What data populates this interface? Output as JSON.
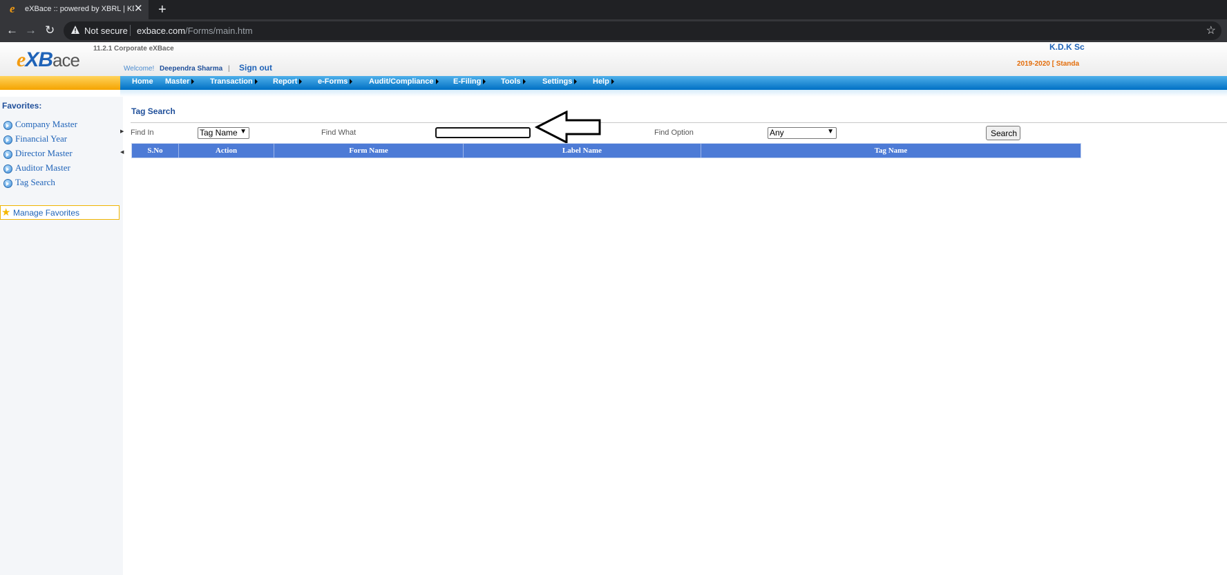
{
  "browser": {
    "tab_title": "eXBace :: powered by XBRL | KDK",
    "tab_favicon": "e",
    "tab_close": "✕",
    "new_tab": "+",
    "back": "←",
    "forward": "→",
    "reload": "↻",
    "security": "Not secure",
    "url_host": "exbace.com",
    "url_path": "/Forms/main.htm",
    "bookmark_star": "☆"
  },
  "header": {
    "logo_e": "e",
    "logo_xb": "XB",
    "logo_ace": "ace",
    "version": "11.2.1 Corporate eXBace",
    "welcome": "Welcome!",
    "username": "Deependra Sharma",
    "separator": "|",
    "signout": "Sign out",
    "company": "K.D.K Sc",
    "financial_year": "2019-2020 [ Standa"
  },
  "menu": {
    "home": "Home",
    "master": "Master",
    "transaction": "Transaction",
    "report": "Report",
    "eforms": "e-Forms",
    "audit": "Audit/Compliance",
    "efiling": "E-Filing",
    "tools": "Tools",
    "settings": "Settings",
    "help": "Help"
  },
  "sidebar": {
    "favorites_title": "Favorites:",
    "items": [
      {
        "label": "Company Master"
      },
      {
        "label": "Financial Year"
      },
      {
        "label": "Director Master"
      },
      {
        "label": "Auditor Master"
      },
      {
        "label": "Tag Search"
      }
    ],
    "manage_favorites": "Manage Favorites",
    "manage_star": "★"
  },
  "search": {
    "page_title": "Tag Search",
    "find_in_label": "Find In",
    "find_in_value": "Tag Name",
    "find_what_label": "Find What",
    "find_what_value": "",
    "find_option_label": "Find Option",
    "find_option_value": "Any",
    "search_button": "Search"
  },
  "table": {
    "columns": [
      "S.No",
      "Action",
      "Form Name",
      "Label Name",
      "Tag Name"
    ]
  },
  "colors": {
    "menu_blue": "#0070c4",
    "header_blue": "#4d7bd6",
    "accent_orange": "#f5a300",
    "link_blue": "#1f63b8"
  }
}
